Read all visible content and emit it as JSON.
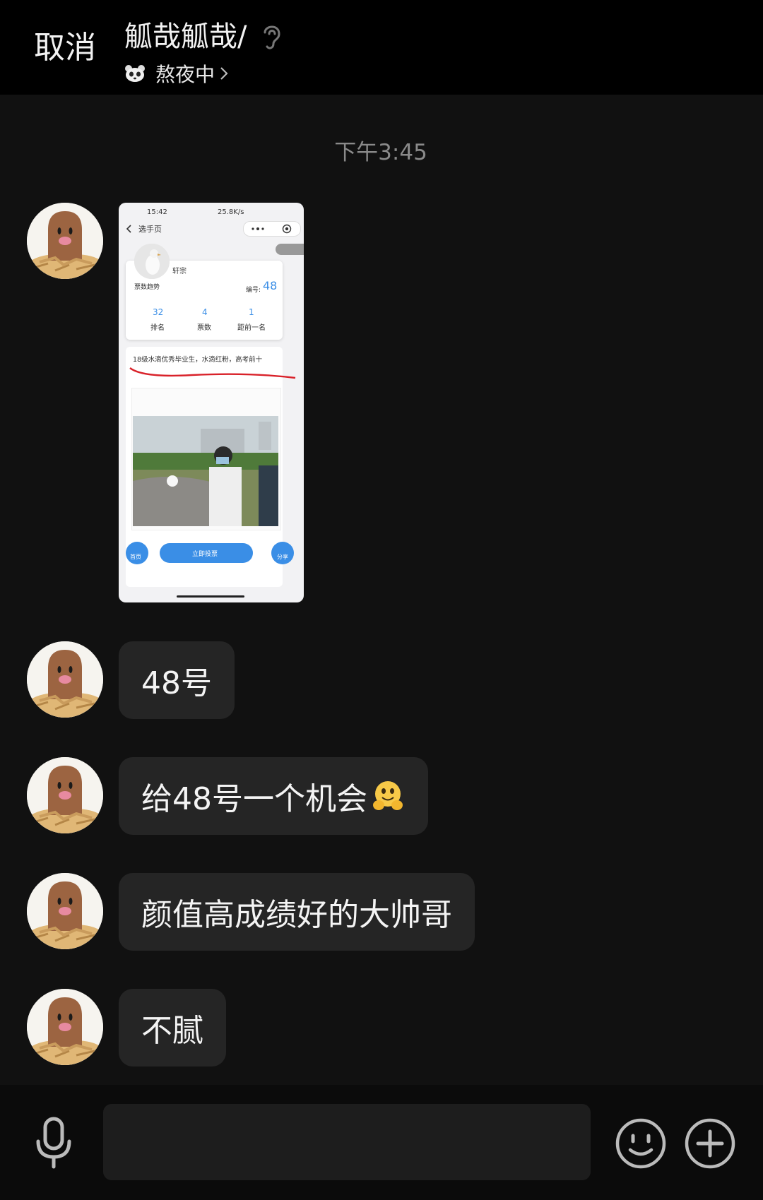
{
  "header": {
    "cancel_label": "取消",
    "title": "觚哉觚哉/",
    "status": "熬夜中"
  },
  "timestamp": "下午3:45",
  "shared_screenshot": {
    "status_time": "15:42",
    "status_right": "25.8K/s",
    "nav_title": "选手页",
    "name": "轩宗",
    "trend_label": "票数趋势",
    "number_label": "编号:",
    "number_value": "48",
    "stats": [
      {
        "value": "32",
        "label": "排名"
      },
      {
        "value": "4",
        "label": "票数"
      },
      {
        "value": "1",
        "label": "距前一名"
      }
    ],
    "description": "18级水滴优秀毕业生，水滴红粉，高考前十",
    "home_label": "首页",
    "vote_label": "立即投票",
    "share_label": "分享"
  },
  "messages": [
    {
      "text": "48号"
    },
    {
      "text": "给48号一个机会"
    },
    {
      "text": "颜值高成绩好的大帅哥"
    },
    {
      "text": "不腻"
    }
  ],
  "input": {
    "placeholder": ""
  },
  "icons": {
    "ear": "ear-icon",
    "voice": "microphone-icon",
    "emoji": "smiley-face-icon",
    "more": "plus-circle-icon"
  }
}
